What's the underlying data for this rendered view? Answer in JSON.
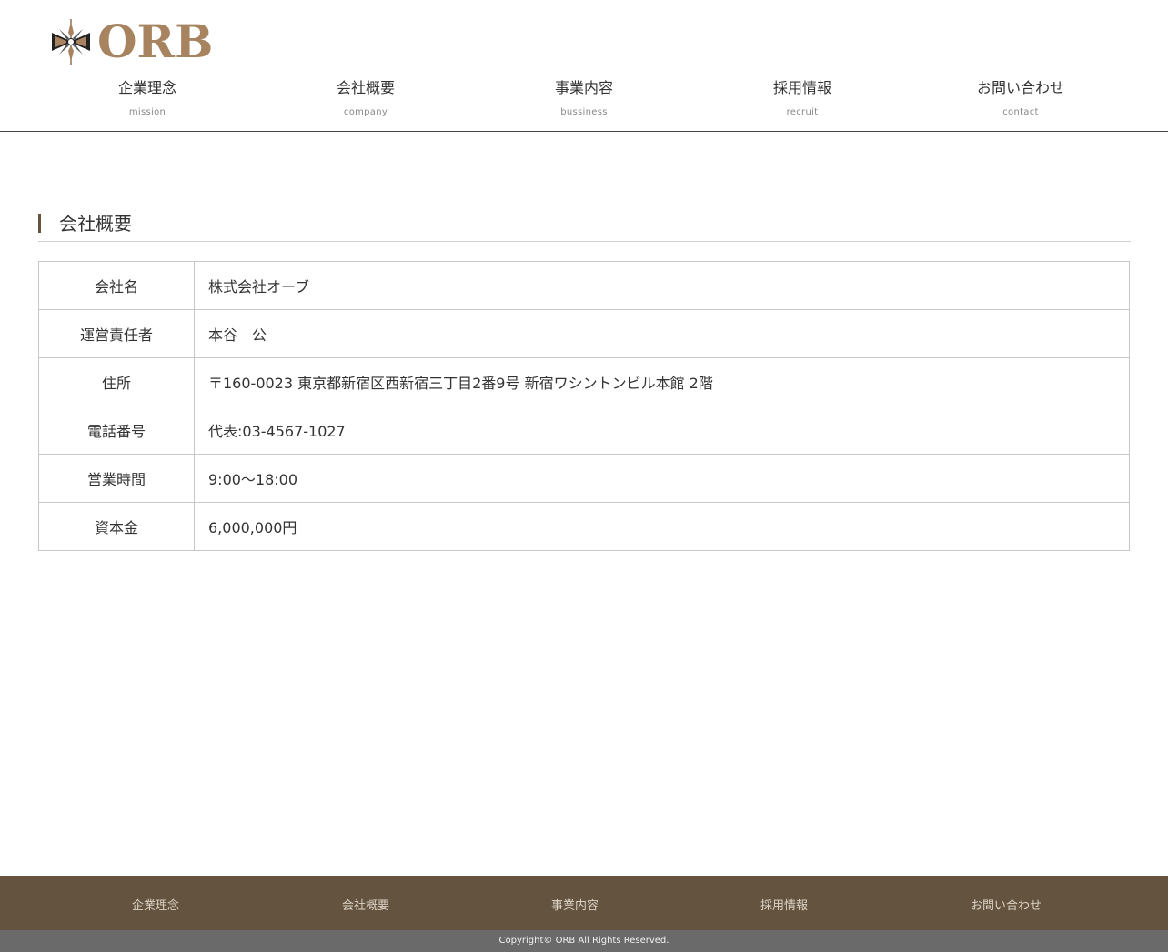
{
  "brand": {
    "name": "ORB",
    "accent": "#a7835f",
    "brown": "#64543f"
  },
  "nav": [
    {
      "jp": "企業理念",
      "en": "mission"
    },
    {
      "jp": "会社概要",
      "en": "company"
    },
    {
      "jp": "事業内容",
      "en": "bussiness"
    },
    {
      "jp": "採用情報",
      "en": "recruit"
    },
    {
      "jp": "お問い合わせ",
      "en": "contact"
    }
  ],
  "section": {
    "title": "会社概要"
  },
  "company_table": [
    {
      "label": "会社名",
      "value": "株式会社オーブ"
    },
    {
      "label": "運営責任者",
      "value": "本谷　公"
    },
    {
      "label": "住所",
      "value": "〒160-0023 東京都新宿区西新宿三丁目2番9号 新宿ワシントンビル本館 2階"
    },
    {
      "label": "電話番号",
      "value": "代表:03-4567-1027"
    },
    {
      "label": "営業時間",
      "value": "9:00～18:00"
    },
    {
      "label": "資本金",
      "value": "6,000,000円"
    }
  ],
  "footer": {
    "nav": [
      "企業理念",
      "会社概要",
      "事業内容",
      "採用情報",
      "お問い合わせ"
    ],
    "copyright": "Copyright© ORB All Rights Reserved."
  }
}
